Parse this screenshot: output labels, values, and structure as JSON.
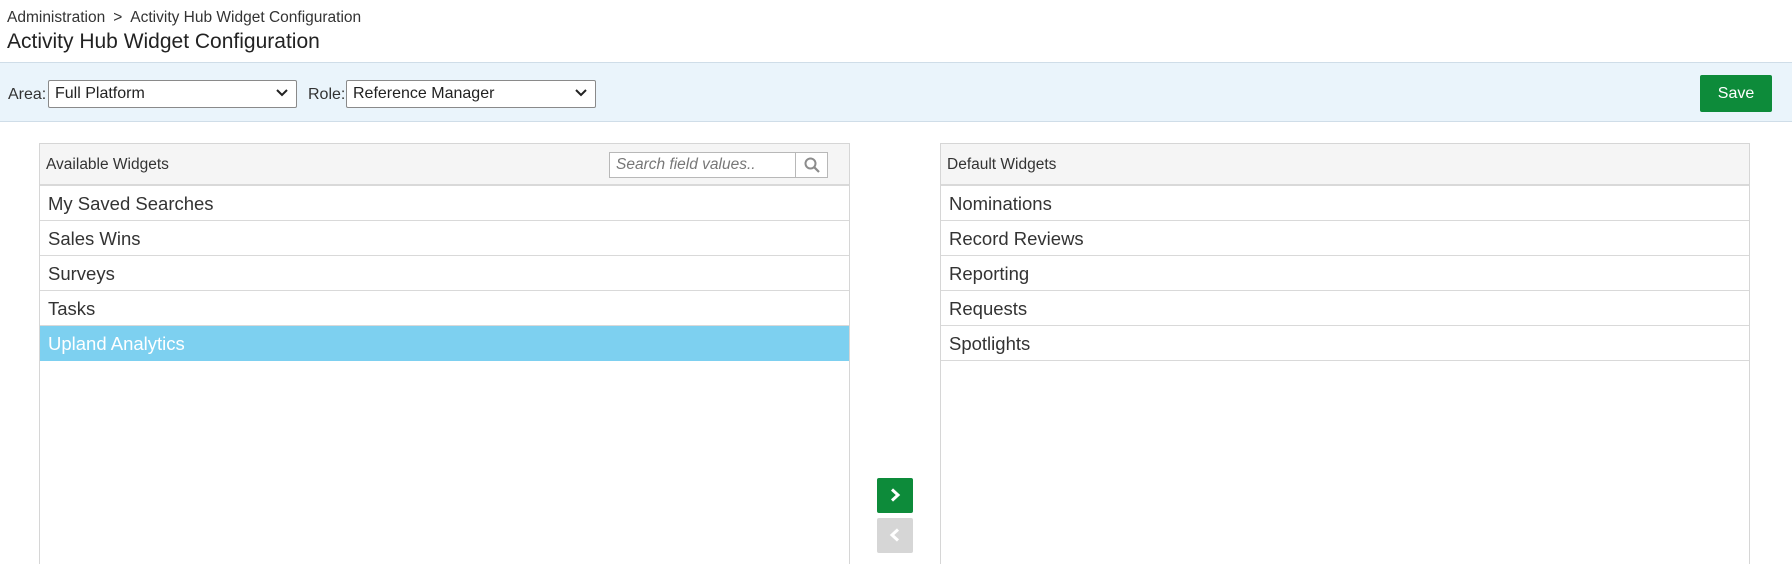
{
  "breadcrumb": {
    "parent": "Administration",
    "separator": ">",
    "current": "Activity Hub Widget Configuration"
  },
  "page_title": "Activity Hub Widget Configuration",
  "toolbar": {
    "area_label": "Area:",
    "area_value": "Full Platform",
    "role_label": "Role:",
    "role_value": "Reference Manager",
    "save_label": "Save"
  },
  "available": {
    "title": "Available Widgets",
    "search_placeholder": "Search field values..",
    "items": [
      "My Saved Searches",
      "Sales Wins",
      "Surveys",
      "Tasks",
      "Upland Analytics"
    ],
    "selected": "Upland Analytics"
  },
  "default": {
    "title": "Default Widgets",
    "items": [
      "Nominations",
      "Record Reviews",
      "Reporting",
      "Requests",
      "Spotlights"
    ]
  },
  "colors": {
    "accent_green": "#0d8b3a",
    "selection_blue": "#7dd0f0",
    "toolbar_bg": "#eaf4fb",
    "disabled_gray": "#d6d6d6"
  },
  "icons": {
    "search": "search-icon",
    "move_right": "chevron-right-icon",
    "move_left": "chevron-left-icon",
    "dropdown": "chevron-down-icon"
  }
}
